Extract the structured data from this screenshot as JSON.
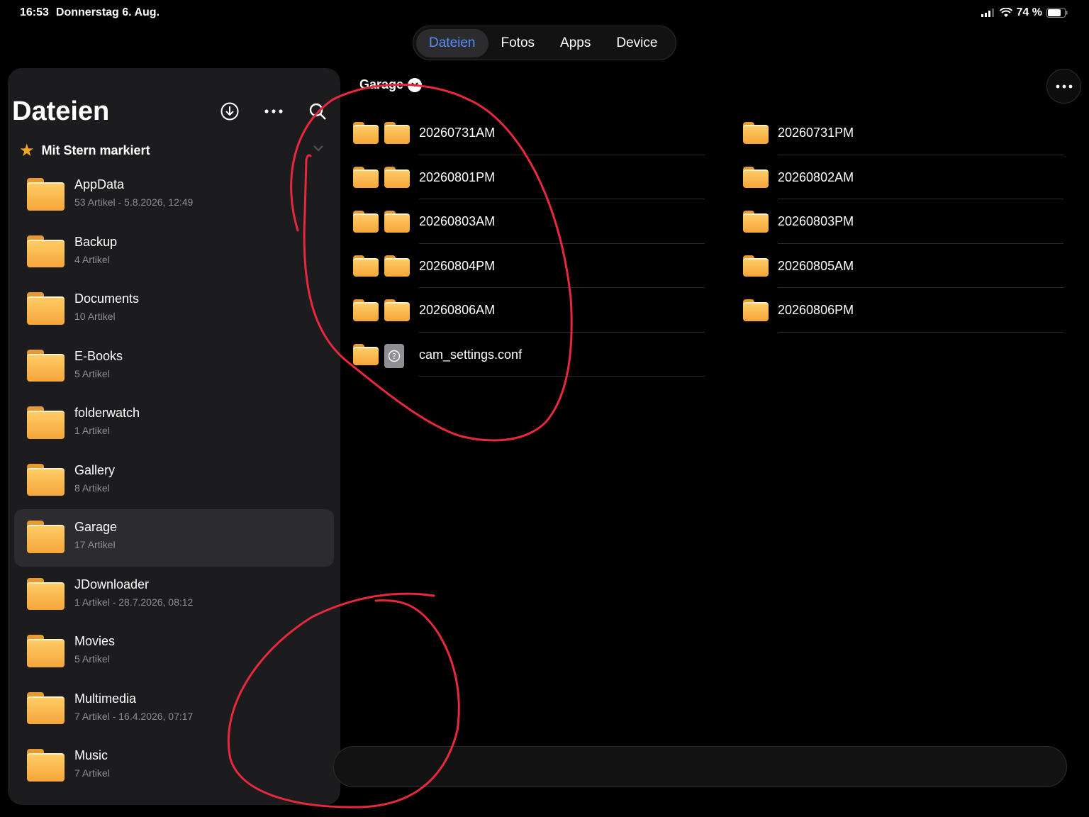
{
  "status_bar": {
    "time": "16:53",
    "date": "Donnerstag 6. Aug.",
    "battery": "74 %"
  },
  "tabs": [
    {
      "label": "Dateien",
      "active": true
    },
    {
      "label": "Fotos",
      "active": false
    },
    {
      "label": "Apps",
      "active": false
    },
    {
      "label": "Device",
      "active": false
    }
  ],
  "sidebar": {
    "title": "Dateien",
    "favorites_label": "Mit Stern markiert",
    "items": [
      {
        "name": "AppData",
        "meta": "53 Artikel - 5.8.2026, 12:49"
      },
      {
        "name": "Backup",
        "meta": "4 Artikel"
      },
      {
        "name": "Documents",
        "meta": "10 Artikel"
      },
      {
        "name": "E-Books",
        "meta": "5 Artikel"
      },
      {
        "name": "folderwatch",
        "meta": "1 Artikel"
      },
      {
        "name": "Gallery",
        "meta": "8 Artikel"
      },
      {
        "name": "Garage",
        "meta": "17 Artikel",
        "selected": true
      },
      {
        "name": "JDownloader",
        "meta": "1 Artikel - 28.7.2026, 08:12"
      },
      {
        "name": "Movies",
        "meta": "5 Artikel"
      },
      {
        "name": "Multimedia",
        "meta": "7 Artikel - 16.4.2026, 07:17"
      },
      {
        "name": "Music",
        "meta": "7 Artikel"
      }
    ]
  },
  "main": {
    "breadcrumb": "Garage",
    "left_column": [
      {
        "name": "20260731AM",
        "type": "folder"
      },
      {
        "name": "20260801PM",
        "type": "folder"
      },
      {
        "name": "20260803AM",
        "type": "folder"
      },
      {
        "name": "20260804PM",
        "type": "folder"
      },
      {
        "name": "20260806AM",
        "type": "folder"
      },
      {
        "name": "cam_settings.conf",
        "type": "file"
      }
    ],
    "right_column": [
      {
        "name": "20260731PM",
        "type": "folder"
      },
      {
        "name": "20260802AM",
        "type": "folder"
      },
      {
        "name": "20260803PM",
        "type": "folder"
      },
      {
        "name": "20260805AM",
        "type": "folder"
      },
      {
        "name": "20260806PM",
        "type": "folder"
      }
    ]
  },
  "icons": {
    "download": "download-circle-icon",
    "more": "ellipsis-icon",
    "search": "search-icon",
    "star": "star-icon",
    "chevron": "chevron-down-icon",
    "unknown_file": "question-file-icon"
  },
  "colors": {
    "accent": "#5b8cff",
    "folder": "#f5a53a",
    "annotation": "#e8283c",
    "star": "#f5a623"
  }
}
